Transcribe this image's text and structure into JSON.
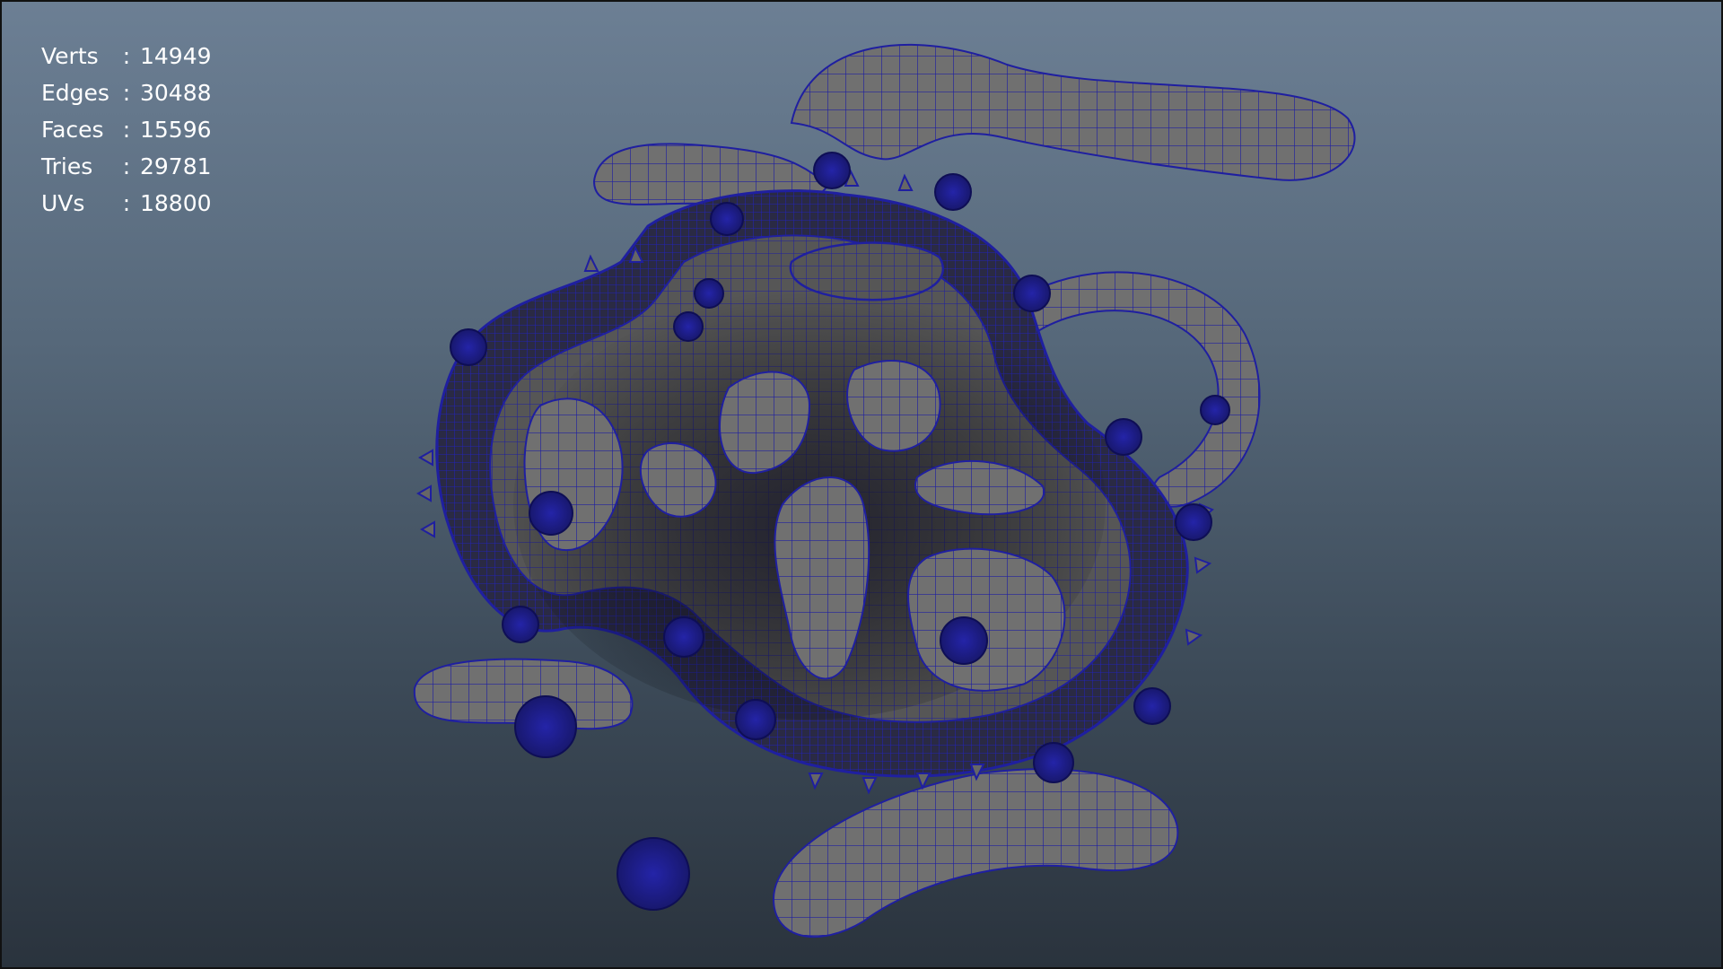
{
  "hud": {
    "stats": [
      {
        "label": "Verts",
        "value": "14949"
      },
      {
        "label": "Edges",
        "value": "30488"
      },
      {
        "label": "Faces",
        "value": "15596"
      },
      {
        "label": "Tries",
        "value": "29781"
      },
      {
        "label": "UVs",
        "value": "18800"
      }
    ],
    "separator": ":"
  },
  "colors": {
    "background_top": "#6c7f94",
    "background_bottom": "#2a333d",
    "mesh_fill": "#6e6e6e",
    "mesh_shadow": "#3a3a3a",
    "wireframe": "#1f1fa0",
    "hud_text": "#ffffff"
  }
}
